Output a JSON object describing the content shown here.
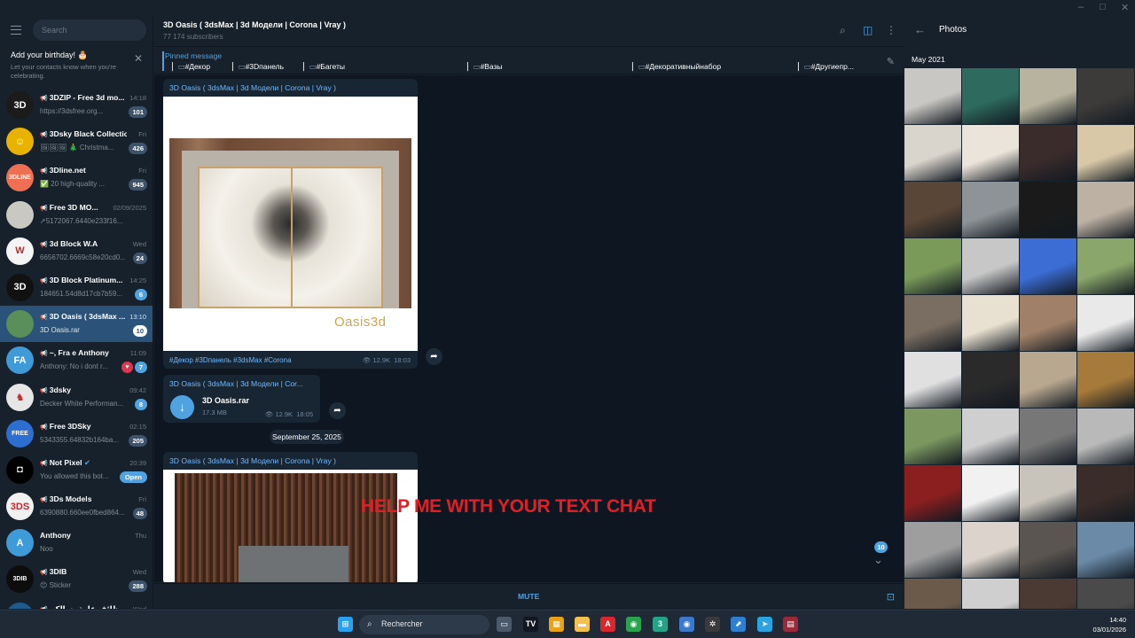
{
  "window": {
    "controls": [
      "–",
      "□",
      "✕"
    ]
  },
  "sidebar": {
    "search_placeholder": "Search",
    "birthday": {
      "title": "Add your birthday! 🎂",
      "text": "Let your contacts know when you're celebrating."
    },
    "chats": [
      {
        "name": "3DZIP - Free 3d mo...",
        "time": "14:18",
        "preview": "https://3dsfree.org...",
        "badge": "101",
        "avatar_text": "3D",
        "avatar_color": "#1b1b1b"
      },
      {
        "name": "3Dsky Black Collectio...",
        "time": "Fri",
        "preview": "🖼🖼🖼 🎄 Christma...",
        "badge": "426",
        "avatar_text": "☺",
        "avatar_color": "#e8b300"
      },
      {
        "name": "3Dline.net",
        "time": "Fri",
        "preview": "✅ 20 high-quality ...",
        "badge": "945",
        "avatar_text": "3DLINE",
        "avatar_color": "#ef6f53"
      },
      {
        "name": "Free 3D MO...",
        "time": "02/09/2025",
        "preview": "➚5172067.6440e233f16...",
        "badge": "",
        "avatar_text": "",
        "avatar_color": "#c9c9c2"
      },
      {
        "name": "3d Block W.A",
        "time": "Wed",
        "preview": "6656702.6669c58e20cd0...",
        "badge": "24",
        "avatar_text": "W",
        "avatar_color": "#f4f4f4"
      },
      {
        "name": "3D Block Platinum...",
        "time": "14:25",
        "preview": "184651.54d8d17cb7b59...",
        "badge": "6",
        "avatar_text": "3D",
        "avatar_color": "#111111"
      },
      {
        "name": "3D Oasis ( 3dsMax ...",
        "time": "13:10",
        "preview": "3D Oasis.rar",
        "badge": "10",
        "avatar_text": "",
        "avatar_color": "#5a8f5a",
        "active": true
      },
      {
        "name": "~, Fra e Anthony",
        "time": "11:09",
        "preview": "Anthony: No i dont r...",
        "badge": "7",
        "avatar_text": "FA",
        "avatar_color": "#3f9ad8",
        "heart": true
      },
      {
        "name": "3dsky",
        "time": "09:42",
        "preview": "Decker White Performan...",
        "badge": "8",
        "avatar_text": "♞",
        "avatar_color": "#e6e6e6"
      },
      {
        "name": "Free 3DSky",
        "time": "02:15",
        "preview": "5343355.64832b164ba...",
        "badge": "205",
        "avatar_text": "FREE",
        "avatar_color": "#2d6fd1"
      },
      {
        "name": "Not Pixel",
        "time": "20:39",
        "preview": "You allowed this bot...",
        "badge": "Open",
        "avatar_text": "◘",
        "avatar_color": "#000000",
        "verified": true,
        "check": true
      },
      {
        "name": "3Ds Models",
        "time": "Fri",
        "preview": "6390880.660ee0fbed864...",
        "badge": "48",
        "avatar_text": "3DS",
        "avatar_color": "#f1f1f1"
      },
      {
        "name": "Anthony",
        "time": "Thu",
        "preview": "Noo",
        "badge": "",
        "avatar_text": "A",
        "avatar_color": "#3f9ad8",
        "nomic": true
      },
      {
        "name": "3DIB",
        "time": "Wed",
        "preview": "😊 Sticker",
        "badge": "288",
        "avatar_text": "3DIB",
        "avatar_color": "#0d0d0d"
      },
      {
        "name": "وظائف عامة بسالكم ...",
        "time": "Wed",
        "preview": "",
        "badge": "",
        "avatar_text": "",
        "avatar_color": "#1e5a8c"
      }
    ]
  },
  "header": {
    "title": "3D Oasis ( 3dsMax | 3d Модели | Corona | Vray )",
    "subscribers": "77 174 subscribers"
  },
  "pinned": {
    "label": "Pinned message",
    "tags": [
      "#Декор",
      "#3Dпанель",
      "#Багеты",
      "#Вазы",
      "#Декоративныйнабор",
      "#Другиепр..."
    ]
  },
  "messages": {
    "post1": {
      "channel": "3D Oasis ( 3dsMax | 3d Модели | Corona | Vray )",
      "caption": "#Декор #3Dпанель #3dsMax #Corona",
      "views": "12.9K",
      "time": "18:03",
      "watermark": "Oasis3d"
    },
    "file": {
      "channel": "3D Oasis ( 3dsMax | 3d Модели | Cor...",
      "filename": "3D Oasis.rar",
      "size": "17.3 MB",
      "views": "12.9K",
      "time": "18:05"
    },
    "date_divider": "September 25, 2025",
    "post2": {
      "channel": "3D Oasis ( 3dsMax | 3d Модели | Corona | Vray )"
    },
    "overlay_text": "HELP ME WITH YOUR TEXT CHAT",
    "unread_count": "10"
  },
  "mutebar": {
    "label": "MUTE"
  },
  "photos": {
    "title": "Photos",
    "month": "May 2021",
    "tiles": [
      "#c9c7c3",
      "#2e6b5e",
      "#b8b39e",
      "#3d3b39",
      "#d9d4cc",
      "#ebe4da",
      "#3b2c2c",
      "#d8c8a8",
      "#5a4636",
      "#8d9396",
      "#1a1a1a",
      "#bdb1a3",
      "#7a9a5a",
      "#c7c7c7",
      "#3b6dd4",
      "#8aa66a",
      "#7a6e62",
      "#e8e0d0",
      "#a08068",
      "#e9e9e9",
      "#e0e0e0",
      "#2a2a2a",
      "#b8a890",
      "#a67a3a",
      "#7c9860",
      "#cfcfcf",
      "#777777",
      "#b9b9b9",
      "#8b1f1f",
      "#f1f1f1",
      "#c8c4bc",
      "#3a2c28",
      "#9e9e9e",
      "#dcd4cc",
      "#5a5550",
      "#6a8aa8",
      "#6b5a4a",
      "#cfcfcf",
      "#4a3a33",
      "#4a4a4a"
    ]
  },
  "taskbar": {
    "search_label": "Rechercher",
    "time": "14:40",
    "date": "03/01/2026",
    "icons": [
      {
        "name": "windows-start-icon",
        "glyph": "⊞",
        "color": "#2aa0f0"
      },
      {
        "name": "task-view-icon",
        "glyph": "▭",
        "color": "#4b5a6a"
      },
      {
        "name": "tradingview-icon",
        "glyph": "TV",
        "color": "#131722"
      },
      {
        "name": "store-icon",
        "glyph": "▦",
        "color": "#e7a21a"
      },
      {
        "name": "folder-icon",
        "glyph": "▬",
        "color": "#f2c14e"
      },
      {
        "name": "acrobat-icon",
        "glyph": "A",
        "color": "#d9272e"
      },
      {
        "name": "chrome-icon",
        "glyph": "◉",
        "color": "#2ba24c"
      },
      {
        "name": "app-3-icon",
        "glyph": "3",
        "color": "#25a389"
      },
      {
        "name": "chrome-profile-icon",
        "glyph": "◉",
        "color": "#3d79c9"
      },
      {
        "name": "chatgpt-icon",
        "glyph": "✲",
        "color": "#3a3a3a"
      },
      {
        "name": "app-blue-icon",
        "glyph": "⬈",
        "color": "#2f7fd0"
      },
      {
        "name": "telegram-icon",
        "glyph": "➤",
        "color": "#2aa4e0"
      },
      {
        "name": "winrar-icon",
        "glyph": "▤",
        "color": "#9a2a3a"
      }
    ]
  }
}
